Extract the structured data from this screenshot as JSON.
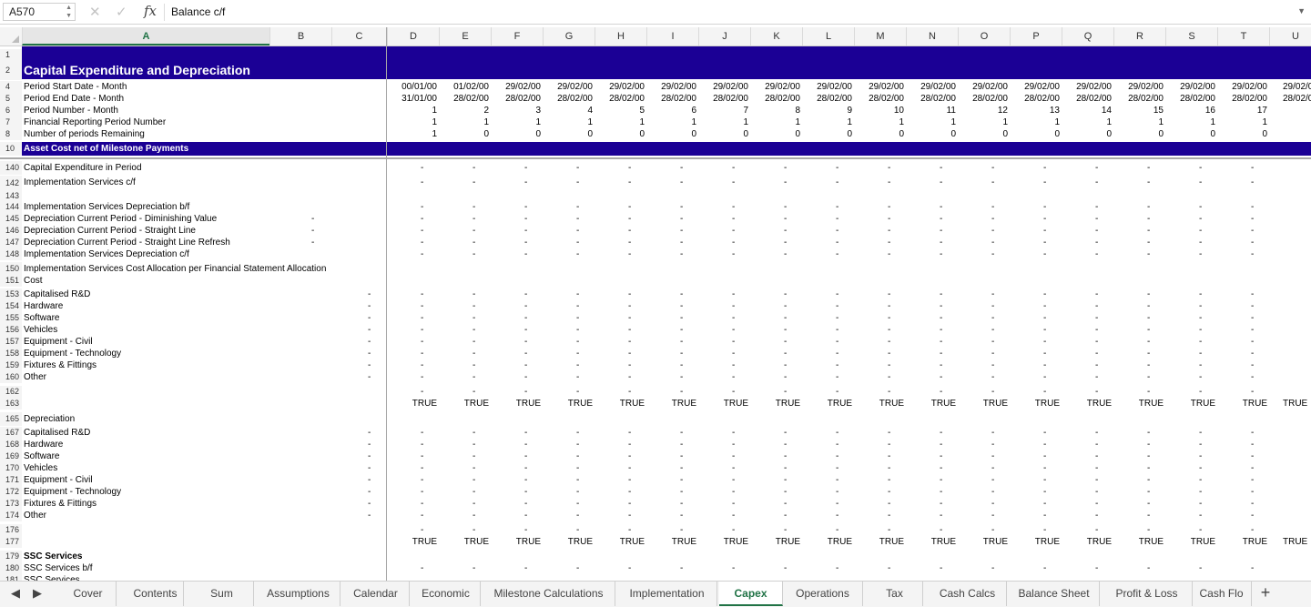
{
  "formula_bar": {
    "name_box": "A570",
    "formula": "Balance c/f"
  },
  "columns": [
    "A",
    "B",
    "C",
    "D",
    "E",
    "F",
    "G",
    "H",
    "I",
    "J",
    "K",
    "L",
    "M",
    "N",
    "O",
    "P",
    "Q",
    "R",
    "S",
    "T",
    "U"
  ],
  "selected_column": "A",
  "rows": [
    {
      "n": "1",
      "label": ""
    },
    {
      "n": "2",
      "label": "Capital Expenditure and Depreciation"
    },
    {
      "n": "4",
      "label": "Period Start Date - Month",
      "vals": [
        "00/01/00",
        "01/02/00",
        "29/02/00",
        "29/02/00",
        "29/02/00",
        "29/02/00",
        "29/02/00",
        "29/02/00",
        "29/02/00",
        "29/02/00",
        "29/02/00",
        "29/02/00",
        "29/02/00",
        "29/02/00",
        "29/02/00",
        "29/02/00",
        "29/02/00",
        "29/02/0"
      ]
    },
    {
      "n": "5",
      "label": "Period End Date - Month",
      "vals": [
        "31/01/00",
        "28/02/00",
        "28/02/00",
        "28/02/00",
        "28/02/00",
        "28/02/00",
        "28/02/00",
        "28/02/00",
        "28/02/00",
        "28/02/00",
        "28/02/00",
        "28/02/00",
        "28/02/00",
        "28/02/00",
        "28/02/00",
        "28/02/00",
        "28/02/00",
        "28/02/0"
      ]
    },
    {
      "n": "6",
      "label": "Period Number - Month",
      "vals": [
        "1",
        "2",
        "3",
        "4",
        "5",
        "6",
        "7",
        "8",
        "9",
        "10",
        "11",
        "12",
        "13",
        "14",
        "15",
        "16",
        "17",
        ""
      ]
    },
    {
      "n": "7",
      "label": "Financial Reporting Period Number",
      "vals": [
        "1",
        "1",
        "1",
        "1",
        "1",
        "1",
        "1",
        "1",
        "1",
        "1",
        "1",
        "1",
        "1",
        "1",
        "1",
        "1",
        "1",
        ""
      ]
    },
    {
      "n": "8",
      "label": "Number of periods Remaining",
      "vals": [
        "1",
        "0",
        "0",
        "0",
        "0",
        "0",
        "0",
        "0",
        "0",
        "0",
        "0",
        "0",
        "0",
        "0",
        "0",
        "0",
        "0",
        ""
      ]
    },
    {
      "n": "10",
      "label": "Asset Cost net of Milestone Payments"
    },
    {
      "n": "140",
      "label": "Capital Expenditure in Period",
      "dash": true
    },
    {
      "n": "142",
      "label": "Implementation Services c/f",
      "dash": true
    },
    {
      "n": "143",
      "label": ""
    },
    {
      "n": "144",
      "label": "Implementation Services Depreciation b/f",
      "dash": true
    },
    {
      "n": "145",
      "label": "Depreciation Current Period - Diminishing Value",
      "b": "-",
      "dash": true
    },
    {
      "n": "146",
      "label": "Depreciation Current Period - Straight Line",
      "b": "-",
      "dash": true
    },
    {
      "n": "147",
      "label": "Depreciation Current Period - Straight Line Refresh",
      "b": "-",
      "dash": true
    },
    {
      "n": "148",
      "label": "Implementation Services Depreciation c/f",
      "dash": true
    },
    {
      "n": "150",
      "label": "Implementation Services Cost Allocation per Financial Statement Allocation"
    },
    {
      "n": "151",
      "label": "Cost"
    },
    {
      "n": "153",
      "label": "Capitalised R&D",
      "c": "-",
      "dash": true
    },
    {
      "n": "154",
      "label": "Hardware",
      "c": "-",
      "dash": true
    },
    {
      "n": "155",
      "label": "Software",
      "c": "-",
      "dash": true
    },
    {
      "n": "156",
      "label": "Vehicles",
      "c": "-",
      "dash": true
    },
    {
      "n": "157",
      "label": "Equipment - Civil",
      "c": "-",
      "dash": true
    },
    {
      "n": "158",
      "label": "Equipment - Technology",
      "c": "-",
      "dash": true
    },
    {
      "n": "159",
      "label": "Fixtures & Fittings",
      "c": "-",
      "dash": true
    },
    {
      "n": "160",
      "label": "Other",
      "c": "-",
      "dash": true
    },
    {
      "n": "162",
      "label": "",
      "dash": true
    },
    {
      "n": "163",
      "label": "",
      "truerow": true
    },
    {
      "n": "165",
      "label": "Depreciation"
    },
    {
      "n": "167",
      "label": "Capitalised R&D",
      "c": "-",
      "dash": true
    },
    {
      "n": "168",
      "label": "Hardware",
      "c": "-",
      "dash": true
    },
    {
      "n": "169",
      "label": "Software",
      "c": "-",
      "dash": true
    },
    {
      "n": "170",
      "label": "Vehicles",
      "c": "-",
      "dash": true
    },
    {
      "n": "171",
      "label": "Equipment - Civil",
      "c": "-",
      "dash": true
    },
    {
      "n": "172",
      "label": "Equipment - Technology",
      "c": "-",
      "dash": true
    },
    {
      "n": "173",
      "label": "Fixtures & Fittings",
      "c": "-",
      "dash": true
    },
    {
      "n": "174",
      "label": "Other",
      "c": "-",
      "dash": true
    },
    {
      "n": "176",
      "label": "",
      "dash": true
    },
    {
      "n": "177",
      "label": "",
      "truerow": true
    },
    {
      "n": "179",
      "label": "SSC Services",
      "bold": true
    },
    {
      "n": "180",
      "label": "SSC Services b/f",
      "dash": true
    },
    {
      "n": "181",
      "label": "SSC Services"
    }
  ],
  "true_text": "TRUE",
  "dash_text": "-",
  "sheet_tabs": [
    "Cover",
    "Contents",
    "Sum",
    "Assumptions",
    "Calendar",
    "Economic",
    "Milestone Calculations",
    "Implementation",
    "Capex",
    "Operations",
    "Tax",
    "Cash Calcs",
    "Balance Sheet",
    "Profit & Loss",
    "Cash Flo"
  ],
  "active_tab": "Capex",
  "add_tab": "+",
  "colors": {
    "header_band": "#1b0095",
    "accent": "#217346"
  }
}
